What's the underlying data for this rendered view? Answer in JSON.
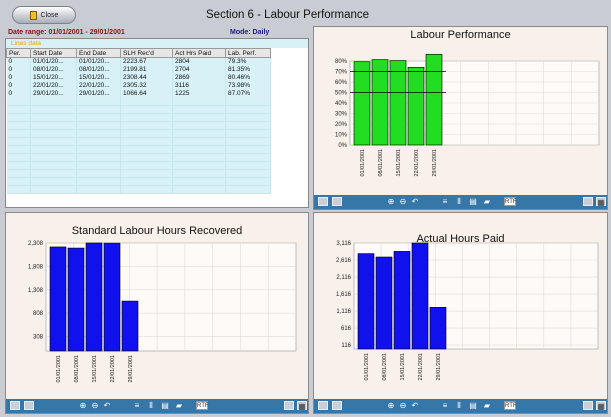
{
  "header": {
    "close_label": "Close",
    "title": "Section 6 - Labour Performance"
  },
  "date_range": "Date range: 01/01/2001 - 29/01/2001",
  "mode": "Mode: Daily",
  "list": {
    "title": "Lines data",
    "columns": [
      "Per.",
      "Start Date",
      "End Date",
      "SLH Rec'd",
      "Act Hrs Paid",
      "Lab. Perf."
    ],
    "rows": [
      [
        "0",
        "01/01/20...",
        "01/01/20...",
        "2223.67",
        "2804",
        "79.3%"
      ],
      [
        "0",
        "08/01/20...",
        "08/01/20...",
        "2199.81",
        "2704",
        "81.35%"
      ],
      [
        "0",
        "15/01/20...",
        "15/01/20...",
        "2308.44",
        "2869",
        "80.46%"
      ],
      [
        "0",
        "22/01/20...",
        "22/01/20...",
        "2305.32",
        "3116",
        "73.98%"
      ],
      [
        "0",
        "29/01/20...",
        "29/01/20...",
        "1066.64",
        "1225",
        "87.07%"
      ]
    ]
  },
  "chart_data": [
    {
      "type": "bar",
      "title": "Labour Performance",
      "categories": [
        "01/01/2001",
        "08/01/2001",
        "15/01/2001",
        "22/01/2001",
        "29/01/2001"
      ],
      "values": [
        79.3,
        81.35,
        80.46,
        73.98,
        87.07
      ],
      "ylim": [
        0,
        80
      ],
      "yticks": [
        "0%",
        "10%",
        "20%",
        "30%",
        "40%",
        "50%",
        "60%",
        "70%",
        "80%"
      ],
      "reference_lines": [
        50,
        70
      ],
      "bar_color": "#22dd22",
      "grid": true
    },
    {
      "type": "bar",
      "title": "Standard Labour Hours Recovered",
      "categories": [
        "01/01/2001",
        "08/01/2001",
        "15/01/2001",
        "22/01/2001",
        "29/01/2001"
      ],
      "values": [
        2223.67,
        2199.81,
        2308.44,
        2305.32,
        1066.64
      ],
      "ylim": [
        0,
        2308
      ],
      "yticks": [
        "308",
        "808",
        "1,308",
        "1,808",
        "2,308"
      ],
      "bar_color": "#1111ee",
      "grid": true
    },
    {
      "type": "bar",
      "title": "Actual Hours Paid",
      "categories": [
        "01/01/2001",
        "08/01/2001",
        "15/01/2001",
        "22/01/2001",
        "29/01/2001"
      ],
      "values": [
        2804,
        2704,
        2869,
        3116,
        1225
      ],
      "ylim": [
        0,
        3116
      ],
      "yticks": [
        "116",
        "616",
        "1,116",
        "1,616",
        "2,116",
        "2,616",
        "3,116"
      ],
      "bar_color": "#1111ee",
      "grid": true
    }
  ],
  "toolbar": {
    "icons": [
      "chart-type-icon",
      "export-icon",
      "zoom-in-icon",
      "zoom-out-icon",
      "undo-zoom-icon",
      "list-icon",
      "columns-icon",
      "notes-icon",
      "3d-toggle-icon",
      "print-icon",
      "copy-icon",
      "grid-icon"
    ],
    "note_label": "RTF"
  }
}
